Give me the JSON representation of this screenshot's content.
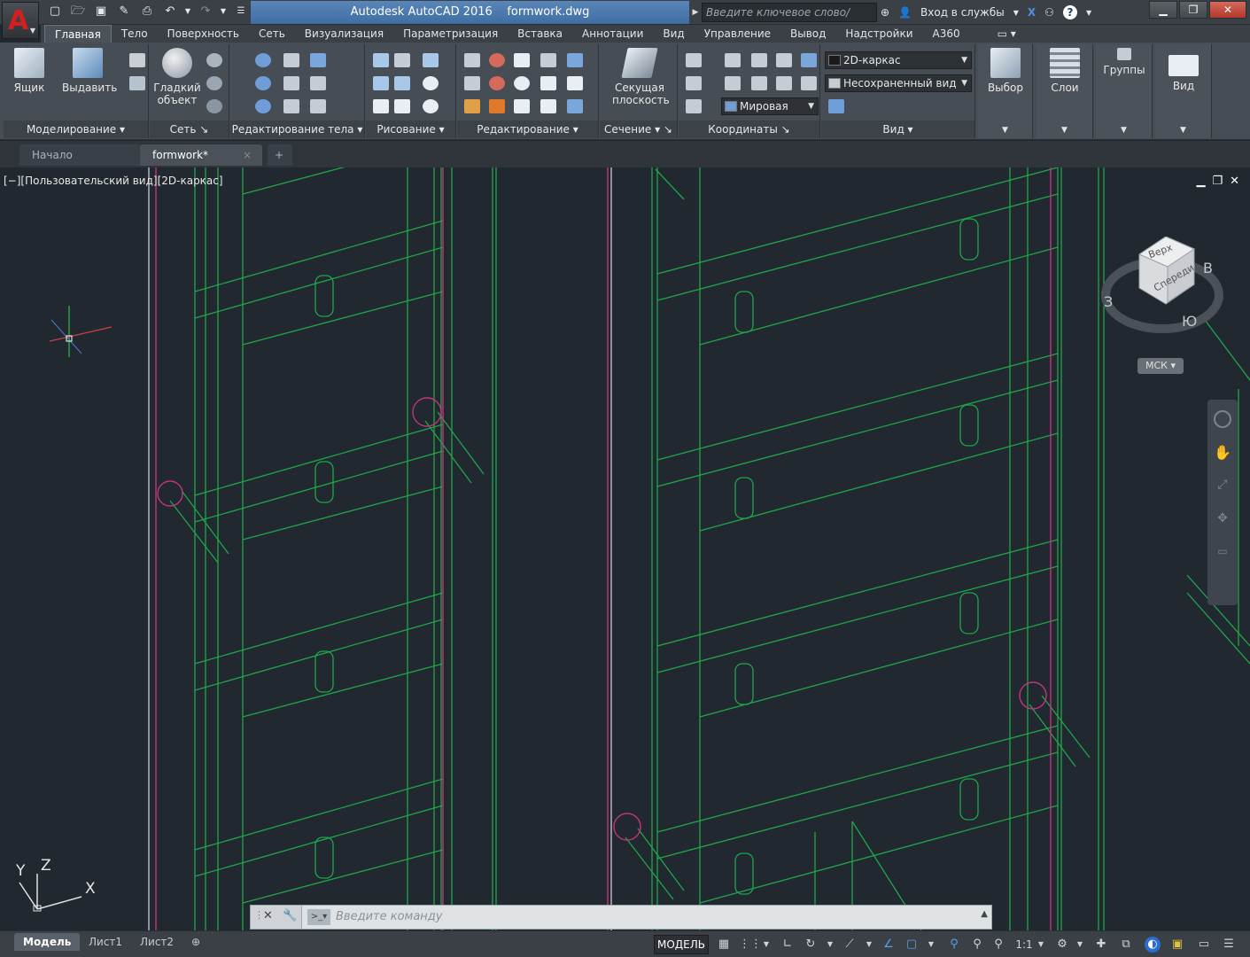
{
  "app": {
    "title": "Autodesk AutoCAD 2016",
    "filename": "formwork.dwg",
    "logo_letter": "A",
    "search_placeholder": "Введите ключевое слово/фразу",
    "signin": "Вход в службы"
  },
  "ribbon_tabs": [
    "Главная",
    "Тело",
    "Поверхность",
    "Сеть",
    "Визуализация",
    "Параметризация",
    "Вставка",
    "Аннотации",
    "Вид",
    "Управление",
    "Вывод",
    "Надстройки",
    "A360"
  ],
  "ribbon": {
    "modeling": {
      "title": "Моделирование",
      "box": "Ящик",
      "extrude": "Выдавить"
    },
    "mesh": {
      "title": "Сеть",
      "smooth": "Гладкий объект"
    },
    "solid_edit": {
      "title": "Редактирование тела"
    },
    "draw": {
      "title": "Рисование"
    },
    "modify": {
      "title": "Редактирование"
    },
    "section": {
      "title": "Сечение",
      "plane": "Секущая плоскость"
    },
    "coords": {
      "title": "Координаты",
      "world": "Мировая"
    },
    "view": {
      "title": "Вид",
      "visual_style": "2D-каркас",
      "named_view": "Несохраненный вид"
    },
    "selection": {
      "label": "Выбор"
    },
    "layers": {
      "label": "Слои"
    },
    "groups": {
      "label": "Группы"
    },
    "viewbtn": {
      "label": "Вид"
    }
  },
  "doc_tabs": {
    "start": "Начало",
    "active": "formwork*",
    "close": "×",
    "add": "+"
  },
  "viewport": {
    "label": "[−][Пользовательский вид][2D-каркас]",
    "viewcube": {
      "top": "Верх",
      "front": "Спереди",
      "west": "З",
      "east": "В",
      "south": "Ю"
    },
    "ucs_name": "МСК",
    "axes": {
      "x": "X",
      "y": "Y",
      "z": "Z"
    }
  },
  "command": {
    "placeholder": "Введите команду"
  },
  "layout_tabs": [
    "Модель",
    "Лист1",
    "Лист2"
  ],
  "status": {
    "model": "МОДЕЛЬ",
    "scale": "1:1"
  },
  "colors": {
    "bg": "#212830",
    "wire_green": "#1fa64a",
    "magenta": "#c2357b"
  }
}
